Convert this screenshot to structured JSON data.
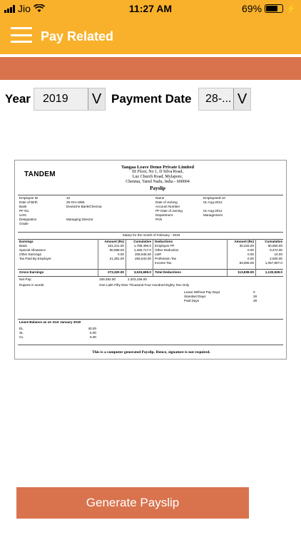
{
  "status_bar": {
    "carrier": "Jio",
    "time": "11:27 AM",
    "battery": "69%"
  },
  "app_bar": {
    "title": "Pay Related"
  },
  "filters": {
    "year_label": "Year",
    "year_value": "2019",
    "payment_date_label": "Payment Date",
    "payment_date_value": "28-...",
    "arrow": "V"
  },
  "payslip": {
    "logo": "TANDEM",
    "company_name": "Tangaa Leave Demo Private Limited",
    "address": [
      "III Floor, No 1, D Silva Road,",
      "Luz Church Road, Mylapore,",
      "Chennai, Tamil Nadu, India - 600004"
    ],
    "title": "Payslip",
    "left_info": [
      [
        "Employee ID",
        "10"
      ],
      [
        "Date of Birth",
        "25-Oct-1955"
      ],
      [
        "Bank",
        "Deutsche Bank/Chennai"
      ],
      [
        "PF No.",
        ""
      ],
      [
        "UAN",
        ""
      ],
      [
        "Designation",
        "Managing Director"
      ],
      [
        "Grade",
        ""
      ]
    ],
    "right_info": [
      [
        "Name",
        "EmployeeId-10"
      ],
      [
        "Date of Joining",
        "01-Aug-2012"
      ],
      [
        "Account Number",
        ""
      ],
      [
        "PF Date of Joining",
        "01-Aug-2012"
      ],
      [
        "Department",
        "Management"
      ],
      [
        "PAN",
        ""
      ]
    ],
    "salary_month": "Salary for the month of February - 2019",
    "earnings_headers": [
      "Earnings",
      "Amount (Rs)",
      "Cumulative"
    ],
    "earnings": [
      [
        "Basic",
        "161,241.00",
        "1,788,490.0"
      ],
      [
        "Special Allowance",
        "90,698.00",
        "1,280,717.0"
      ],
      [
        "Other Earnings",
        "0.00",
        "208,945.00"
      ],
      [
        "Tax Paid By Employer",
        "21,381.00",
        "255,543.00"
      ]
    ],
    "deduction_headers": [
      "Deductions",
      "Amount (Rs)",
      "Cumulative"
    ],
    "deductions": [
      [
        "Employee PF",
        "30,233.00",
        "60,650.00"
      ],
      [
        "Other Deduction",
        "0.00",
        "9,472.00"
      ],
      [
        "LWF",
        "0.00",
        "10.00"
      ],
      [
        "Profession Tax",
        "0.00",
        "2,500.00"
      ],
      [
        "Income Tax",
        "83,605.00",
        "1,057,907.0"
      ]
    ],
    "gross": [
      "Gross Earnings",
      "273,320.00",
      "3,533,695.0"
    ],
    "total_deductions": [
      "Total Deductions",
      "113,838.00",
      "1,130,539.0"
    ],
    "net_pay": [
      "Net Pay:",
      "159,482.00",
      "2,403,156.00"
    ],
    "rupees_label": "Rupees in words:",
    "rupees_words": "One Lakh Fifty Nine Thousand Four Hundred Eighty Two Only",
    "days": [
      [
        "Leave Without Pay Days",
        "0"
      ],
      [
        "Standard Days",
        "28"
      ],
      [
        "Paid Days",
        "28"
      ]
    ],
    "leave_title": "Leave Balance as on 31st January 2019",
    "leave": [
      [
        "EL",
        "40.00"
      ],
      [
        "SL",
        "6.00"
      ],
      [
        "CL",
        "6.00"
      ]
    ],
    "footer": "This is a computer generated Payslip. Hence, signature is not required."
  },
  "actions": {
    "generate_label": "Generate Payslip"
  },
  "colors": {
    "primary": "#F9B12B",
    "accent": "#D9734E"
  }
}
